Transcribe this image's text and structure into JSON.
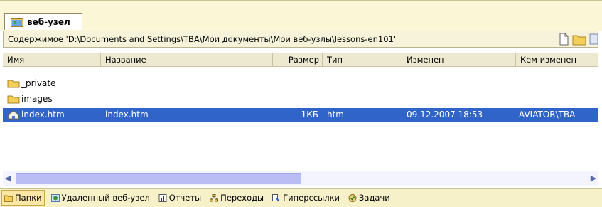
{
  "window": {
    "tab_label": "веб-узел"
  },
  "pathbar": {
    "text": "Содержимое 'D:\\Documents and Settings\\TBA\\Мои документы\\Мои веб-узлы\\lessons-en101'"
  },
  "columns": [
    "Имя",
    "Название",
    "Размер",
    "Тип",
    "Изменен",
    "Кем изменен"
  ],
  "rows": [
    {
      "name": "_private",
      "title": "",
      "size": "",
      "type": "",
      "modified": "",
      "modified_by": "",
      "icon": "folder-icon",
      "selected": false
    },
    {
      "name": "images",
      "title": "",
      "size": "",
      "type": "",
      "modified": "",
      "modified_by": "",
      "icon": "folder-icon",
      "selected": false
    },
    {
      "name": "index.htm",
      "title": "index.htm",
      "size": "1КБ",
      "type": "htm",
      "modified": "09.12.2007 18:53",
      "modified_by": "AVIATOR\\TBA",
      "icon": "home-page-icon",
      "selected": true
    }
  ],
  "bottom_tabs": [
    {
      "label": "Папки",
      "icon": "folder-icon",
      "active": true
    },
    {
      "label": "Удаленный веб-узел",
      "icon": "remote-site-icon",
      "active": false
    },
    {
      "label": "Отчеты",
      "icon": "reports-icon",
      "active": false
    },
    {
      "label": "Переходы",
      "icon": "navigation-icon",
      "active": false
    },
    {
      "label": "Гиперссылки",
      "icon": "hyperlinks-icon",
      "active": false
    },
    {
      "label": "Задачи",
      "icon": "tasks-icon",
      "active": false
    }
  ],
  "colors": {
    "selection": "#3064c8",
    "tabstrip": "#fbf7d6",
    "bottombar": "#f7f1c9"
  }
}
